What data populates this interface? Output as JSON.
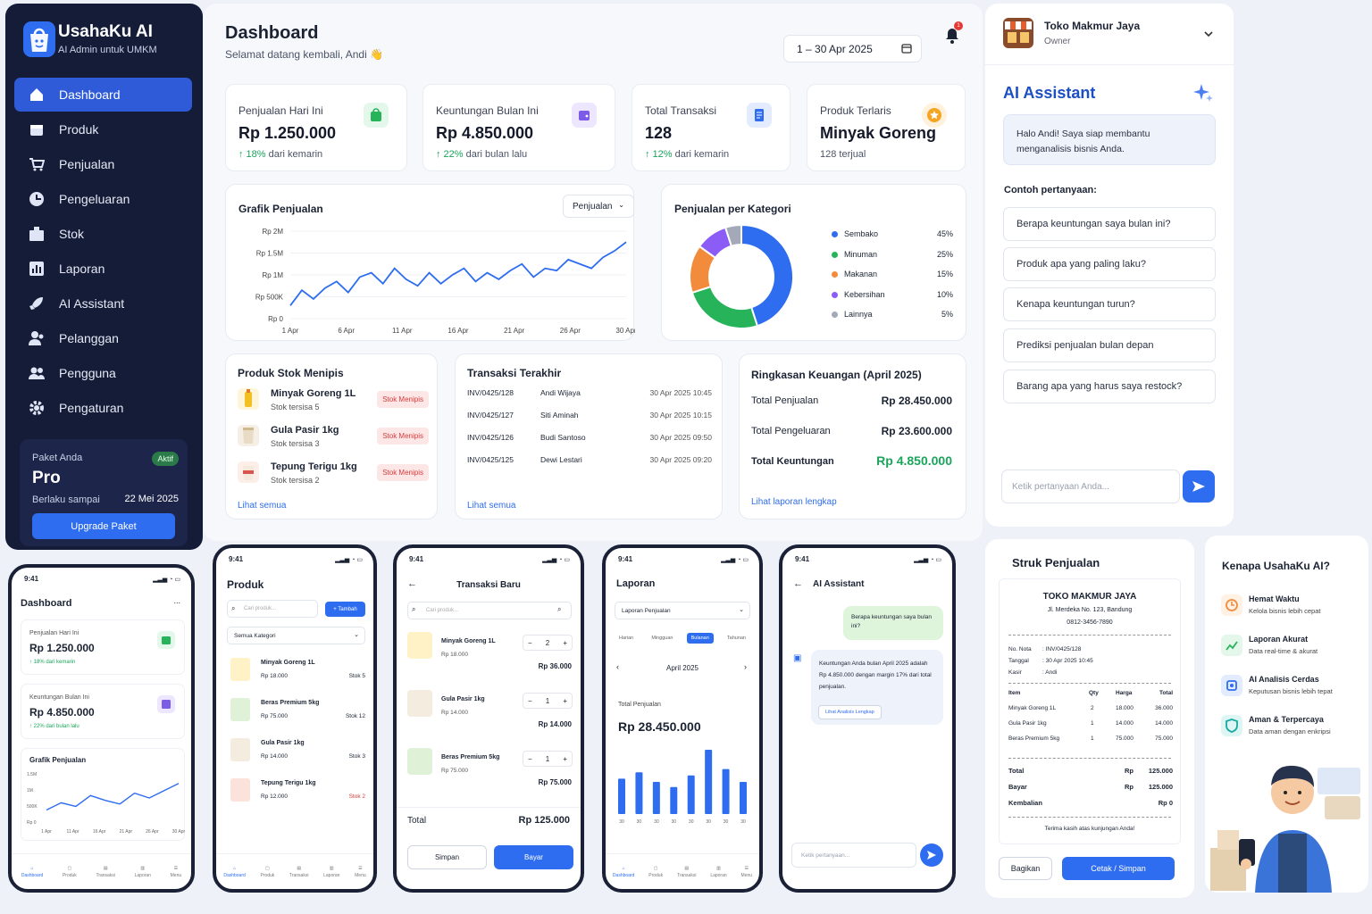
{
  "brand": {
    "name": "UsahaKu AI",
    "subtitle": "AI Admin untuk UMKM"
  },
  "sidebar": {
    "items": [
      {
        "label": "Dashboard",
        "icon": "home-icon"
      },
      {
        "label": "Produk",
        "icon": "box-icon"
      },
      {
        "label": "Penjualan",
        "icon": "cart-icon"
      },
      {
        "label": "Pengeluaran",
        "icon": "wallet-icon"
      },
      {
        "label": "Stok",
        "icon": "stock-icon"
      },
      {
        "label": "Laporan",
        "icon": "report-icon"
      },
      {
        "label": "AI Assistant",
        "icon": "rocket-icon"
      },
      {
        "label": "Pelanggan",
        "icon": "customers-icon"
      },
      {
        "label": "Pengguna",
        "icon": "users-icon"
      },
      {
        "label": "Pengaturan",
        "icon": "gear-icon"
      }
    ],
    "plan": {
      "label": "Paket Anda",
      "badge": "Aktif",
      "name": "Pro",
      "valid_label": "Berlaku sampai",
      "valid_date": "22 Mei 2025",
      "upgrade": "Upgrade Paket"
    }
  },
  "header": {
    "title": "Dashboard",
    "greeting": "Selamat datang kembali, Andi 👋",
    "date_range": "1 – 30 Apr 2025",
    "notif_count": "1"
  },
  "stats": [
    {
      "title": "Penjualan Hari Ini",
      "value": "Rp 1.250.000",
      "delta": "↑ 18%",
      "delta_text": "dari kemarin"
    },
    {
      "title": "Keuntungan Bulan Ini",
      "value": "Rp 4.850.000",
      "delta": "↑ 22%",
      "delta_text": "dari bulan lalu"
    },
    {
      "title": "Total Transaksi",
      "value": "128",
      "delta": "↑ 12%",
      "delta_text": "dari kemarin"
    },
    {
      "title": "Produk Terlaris",
      "value": "Minyak Goreng",
      "delta": "",
      "delta_text": "128 terjual"
    }
  ],
  "sales_chart": {
    "title": "Grafik Penjualan",
    "dropdown": "Penjualan"
  },
  "chart_data": [
    {
      "type": "line",
      "title": "Grafik Penjualan",
      "xlabel": "",
      "ylabel": "",
      "x_ticks": [
        "1 Apr",
        "6 Apr",
        "11 Apr",
        "16 Apr",
        "21 Apr",
        "26 Apr",
        "30 Apr"
      ],
      "y_ticks": [
        "Rp 2M",
        "Rp 1.5M",
        "Rp 1M",
        "Rp 500K",
        "Rp 0"
      ],
      "ylim": [
        0,
        2000000
      ],
      "x": [
        1,
        2,
        3,
        4,
        5,
        6,
        7,
        8,
        9,
        10,
        11,
        12,
        13,
        14,
        15,
        16,
        17,
        18,
        19,
        20,
        21,
        22,
        23,
        24,
        25,
        26,
        27,
        28,
        29,
        30
      ],
      "values": [
        300000,
        650000,
        450000,
        700000,
        850000,
        600000,
        950000,
        1050000,
        800000,
        1150000,
        900000,
        750000,
        1050000,
        800000,
        1000000,
        1150000,
        850000,
        1050000,
        900000,
        1100000,
        1250000,
        950000,
        1150000,
        1100000,
        1350000,
        1250000,
        1150000,
        1400000,
        1550000,
        1750000
      ]
    },
    {
      "type": "pie",
      "title": "Penjualan per Kategori",
      "labels": [
        "Sembako",
        "Minuman",
        "Makanan",
        "Kebersihan",
        "Lainnya"
      ],
      "values": [
        45,
        25,
        15,
        10,
        5
      ],
      "colors": [
        "#2f6df0",
        "#27b35a",
        "#f28c3c",
        "#8b5cf6",
        "#a3a9b8"
      ]
    },
    {
      "type": "line",
      "title": "Grafik Penjualan",
      "x_ticks": [
        "1 Apr",
        "11 Apr",
        "16 Apr",
        "21 Apr",
        "26 Apr",
        "30 Apr"
      ],
      "y_ticks": [
        "1.5M",
        "1M",
        "500K",
        "Rp 0"
      ],
      "ylim": [
        0,
        2000000
      ],
      "values": [
        500000,
        800000,
        650000,
        1100000,
        900000,
        750000,
        1200000,
        1000000,
        1300000,
        1600000
      ]
    },
    {
      "type": "bar",
      "title": "Total Penjualan",
      "categories": [
        "30",
        "30",
        "30",
        "30",
        "30",
        "30",
        "30",
        "30"
      ],
      "values": [
        55,
        65,
        50,
        42,
        60,
        100,
        70,
        50
      ]
    }
  ],
  "category_chart": {
    "title": "Penjualan per Kategori",
    "legend": [
      {
        "name": "Sembako",
        "pct": "45%",
        "color": "#2f6df0"
      },
      {
        "name": "Minuman",
        "pct": "25%",
        "color": "#27b35a"
      },
      {
        "name": "Makanan",
        "pct": "15%",
        "color": "#f28c3c"
      },
      {
        "name": "Kebersihan",
        "pct": "10%",
        "color": "#8b5cf6"
      },
      {
        "name": "Lainnya",
        "pct": "5%",
        "color": "#a3a9b8"
      }
    ]
  },
  "low_stock": {
    "title": "Produk Stok Menipis",
    "badge": "Stok Menipis",
    "link": "Lihat semua",
    "items": [
      {
        "name": "Minyak Goreng 1L",
        "stock": "Stok tersisa 5"
      },
      {
        "name": "Gula Pasir 1kg",
        "stock": "Stok tersisa 3"
      },
      {
        "name": "Tepung Terigu 1kg",
        "stock": "Stok tersisa 2"
      }
    ]
  },
  "transactions": {
    "title": "Transaksi Terakhir",
    "link": "Lihat semua",
    "rows": [
      {
        "id": "INV/0425/128",
        "name": "Andi Wijaya",
        "time": "30 Apr 2025 10:45"
      },
      {
        "id": "INV/0425/127",
        "name": "Siti Aminah",
        "time": "30 Apr 2025 10:15"
      },
      {
        "id": "INV/0425/126",
        "name": "Budi Santoso",
        "time": "30 Apr 2025 09:50"
      },
      {
        "id": "INV/0425/125",
        "name": "Dewi Lestari",
        "time": "30 Apr 2025 09:20"
      }
    ]
  },
  "finance": {
    "title": "Ringkasan Keuangan (April 2025)",
    "rows": [
      {
        "label": "Total Penjualan",
        "value": "Rp 28.450.000"
      },
      {
        "label": "Total Pengeluaran",
        "value": "Rp 23.600.000"
      },
      {
        "label": "Total Keuntungan",
        "value": "Rp 4.850.000"
      }
    ],
    "link": "Lihat laporan lengkap"
  },
  "store": {
    "name": "Toko Makmur Jaya",
    "role": "Owner"
  },
  "assistant": {
    "title": "AI Assistant",
    "greeting": "Halo Andi! Saya siap membantu menganalisis bisnis Anda.",
    "examples_label": "Contoh pertanyaan:",
    "questions": [
      "Berapa keuntungan saya bulan ini?",
      "Produk apa yang paling laku?",
      "Kenapa keuntungan turun?",
      "Prediksi penjualan bulan depan",
      "Barang apa yang harus saya restock?"
    ],
    "placeholder": "Ketik pertanyaan Anda..."
  },
  "phone_common": {
    "time": "9:41",
    "nav": [
      "Dashboard",
      "Produk",
      "Transaksi",
      "Laporan",
      "Menu"
    ]
  },
  "phone1": {
    "title": "Dashboard",
    "menu": "...",
    "c1_title": "Penjualan Hari Ini",
    "c1_value": "Rp 1.250.000",
    "c1_delta": "↑ 18% dari kemarin",
    "c2_title": "Keuntungan Bulan Ini",
    "c2_value": "Rp 4.850.000",
    "c2_delta": "↑ 22% dari bulan lalu",
    "chart_title": "Grafik Penjualan"
  },
  "phone2": {
    "title": "Produk",
    "search": "Cari produk...",
    "add": "+ Tambah",
    "filter": "Semua Kategori",
    "items": [
      {
        "name": "Minyak Goreng 1L",
        "price": "Rp 18.000",
        "stock": "Stok 5"
      },
      {
        "name": "Beras Premium 5kg",
        "price": "Rp 75.000",
        "stock": "Stok 12"
      },
      {
        "name": "Gula Pasir 1kg",
        "price": "Rp 14.000",
        "stock": "Stok 3"
      },
      {
        "name": "Tepung Terigu 1kg",
        "price": "Rp 12.000",
        "stock": "Stok 2"
      }
    ]
  },
  "phone3": {
    "title": "Transaksi Baru",
    "search": "Cari produk...",
    "items": [
      {
        "name": "Minyak Goreng 1L",
        "price": "Rp 18.000",
        "qty": "2",
        "total": "Rp 36.000"
      },
      {
        "name": "Gula Pasir 1kg",
        "price": "Rp 14.000",
        "qty": "1",
        "total": "Rp 14.000"
      },
      {
        "name": "Beras Premium 5kg",
        "price": "Rp 75.000",
        "qty": "1",
        "total": "Rp 75.000"
      }
    ],
    "total_label": "Total",
    "total_value": "Rp 125.000",
    "save": "Simpan",
    "pay": "Bayar"
  },
  "phone4": {
    "title": "Laporan",
    "select": "Laporan Penjualan",
    "tabs": [
      "Harian",
      "Mingguan",
      "Bulanan",
      "Tahunan"
    ],
    "month": "April 2025",
    "total_label": "Total Penjualan",
    "total_value": "Rp 28.450.000"
  },
  "phone5": {
    "title": "AI Assistant",
    "user_msg": "Berapa keuntungan saya bulan ini?",
    "bot_msg": "Keuntungan Anda bulan April 2025 adalah Rp 4.850.000 dengan margin 17% dari total penjualan.",
    "bot_link": "Lihat Analisis Lengkap",
    "placeholder": "Ketik pertanyaan..."
  },
  "receipt": {
    "title": "Struk Penjualan",
    "store": "TOKO MAKMUR JAYA",
    "address": "Jl. Merdeka No. 123, Bandung",
    "phone": "0812-3456-7890",
    "meta": [
      {
        "k": "No. Nota",
        "v": ": INV/0425/128"
      },
      {
        "k": "Tanggal",
        "v": ": 30 Apr 2025 10:45"
      },
      {
        "k": "Kasir",
        "v": ": Andi"
      }
    ],
    "head": [
      "Item",
      "Qty",
      "Harga",
      "Total"
    ],
    "rows": [
      [
        "Minyak Goreng 1L",
        "2",
        "18.000",
        "36.000"
      ],
      [
        "Gula Pasir 1kg",
        "1",
        "14.000",
        "14.000"
      ],
      [
        "Beras Premium 5kg",
        "1",
        "75.000",
        "75.000"
      ]
    ],
    "totals": [
      {
        "k": "Total",
        "c": "Rp",
        "v": "125.000"
      },
      {
        "k": "Bayar",
        "c": "Rp",
        "v": "125.000"
      },
      {
        "k": "Kembalian",
        "c": "",
        "v": "Rp 0"
      }
    ],
    "thanks": "Terima kasih atas kunjungan Anda!",
    "share": "Bagikan",
    "print": "Cetak / Simpan"
  },
  "why": {
    "title": "Kenapa UsahaKu AI?",
    "items": [
      {
        "t": "Hemat Waktu",
        "d": "Kelola bisnis lebih cepat",
        "color": "#f28c3c"
      },
      {
        "t": "Laporan Akurat",
        "d": "Data real-time & akurat",
        "color": "#27b35a"
      },
      {
        "t": "AI Analisis Cerdas",
        "d": "Keputusan bisnis lebih tepat",
        "color": "#2f6df0"
      },
      {
        "t": "Aman & Terpercaya",
        "d": "Data aman dengan enkripsi",
        "color": "#1aa9a0"
      }
    ]
  }
}
